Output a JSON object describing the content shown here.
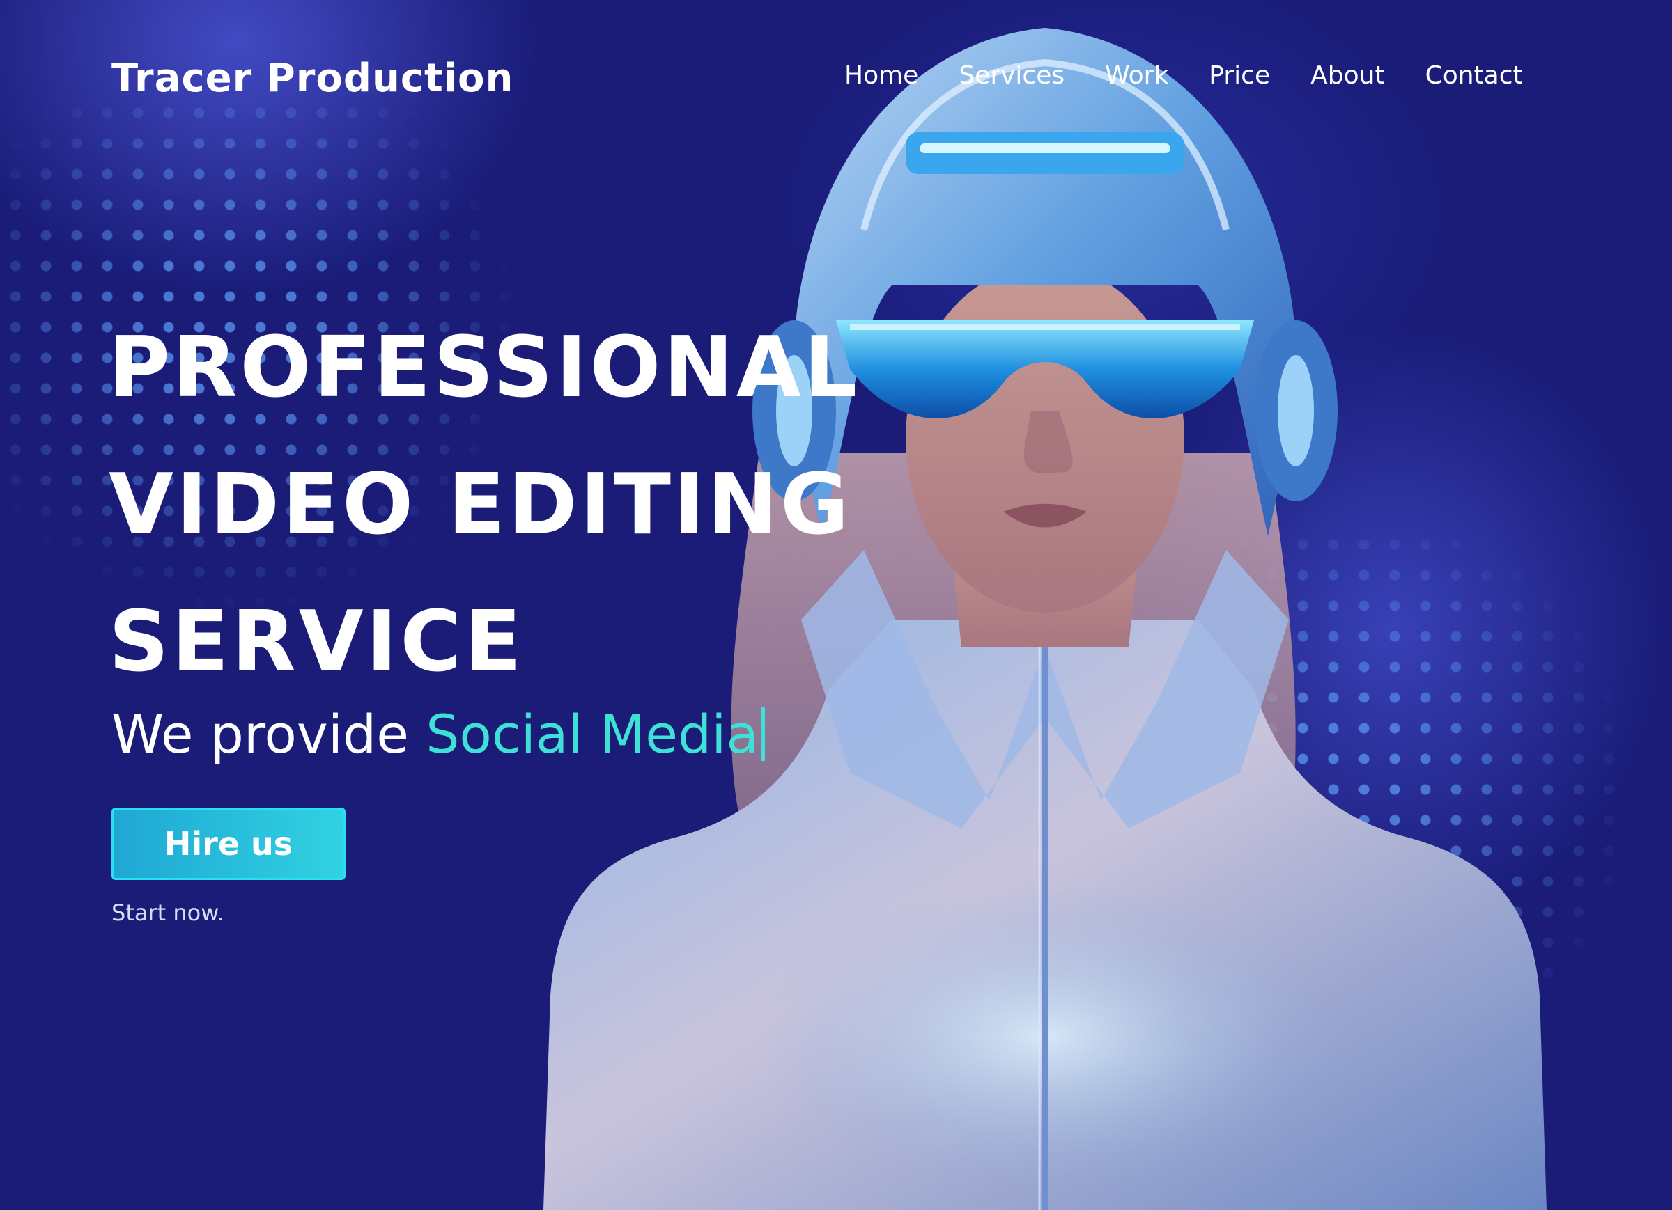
{
  "header": {
    "brand": "Tracer Production",
    "nav": [
      {
        "label": "Home"
      },
      {
        "label": "Services"
      },
      {
        "label": "Work"
      },
      {
        "label": "Price"
      },
      {
        "label": "About"
      },
      {
        "label": "Contact"
      }
    ]
  },
  "hero": {
    "headline_lines": [
      "PROFESSIONAL",
      "VIDEO EDITING",
      "SERVICE"
    ],
    "tagline_prefix": "We provide ",
    "tagline_highlight": "Social Media",
    "cta_label": "Hire us",
    "cta_note": "Start now.",
    "figure_icon": "futuristic-vr-helmet-portrait"
  },
  "colors": {
    "background": "#1a1c78",
    "accent": "#3fe0d6",
    "button": "#1fa7d4",
    "text": "#ffffff"
  }
}
